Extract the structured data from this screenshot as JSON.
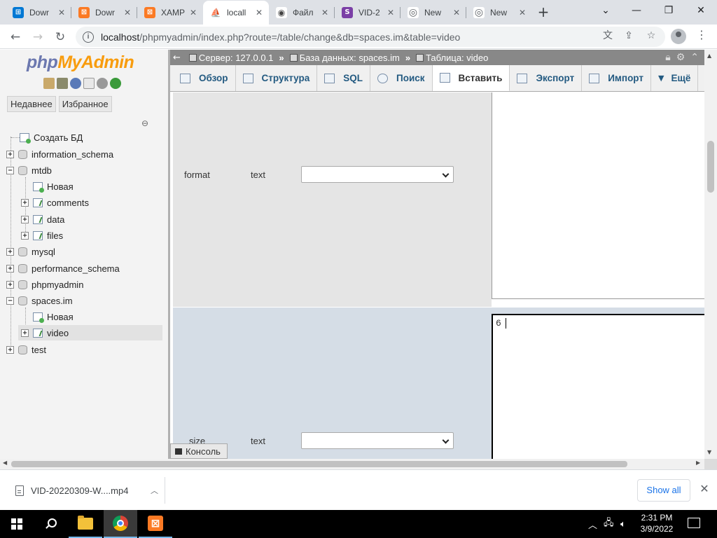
{
  "browser": {
    "tabs": [
      {
        "title": "Dowr",
        "icon": "windows-icon",
        "color": "#0078d4"
      },
      {
        "title": "Dowr",
        "icon": "xampp-icon",
        "color": "#fb7a24"
      },
      {
        "title": "XAMP",
        "icon": "xampp-icon",
        "color": "#fb7a24"
      },
      {
        "title": "locall",
        "icon": "phpmyadmin-icon",
        "color": "#6c78af",
        "active": true
      },
      {
        "title": "Файл",
        "icon": "eye-icon",
        "color": "#444444"
      },
      {
        "title": "VID-2",
        "icon": "s-icon",
        "color": "#7b3fa6"
      },
      {
        "title": "New",
        "icon": "chrome-icon",
        "color": "#5f6368"
      },
      {
        "title": "New",
        "icon": "chrome-icon",
        "color": "#5f6368"
      }
    ],
    "url_host": "localhost",
    "url_path": "/phpmyadmin/index.php?route=/table/change&db=spaces.im&table=video"
  },
  "nav": {
    "logo_php": "php",
    "logo_myadmin": "MyAdmin",
    "tab_recent": "Недавнее",
    "tab_favorites": "Избранное",
    "create_db": "Создать БД",
    "databases": [
      {
        "name": "information_schema"
      },
      {
        "name": "mtdb",
        "expanded": true
      },
      {
        "name": "mysql"
      },
      {
        "name": "performance_schema"
      },
      {
        "name": "phpmyadmin"
      },
      {
        "name": "spaces.im",
        "expanded": true
      },
      {
        "name": "test"
      }
    ],
    "mtdb_children": [
      "Новая",
      "comments",
      "data",
      "files"
    ],
    "spaces_children": [
      "Новая",
      "video"
    ]
  },
  "breadcrumb": {
    "server": "Сервер: 127.0.0.1",
    "database": "База данных: spaces.im",
    "table": "Таблица: video"
  },
  "menu": {
    "browse": "Обзор",
    "structure": "Структура",
    "sql": "SQL",
    "search": "Поиск",
    "insert": "Вставить",
    "export": "Экспорт",
    "import": "Импорт",
    "more": "Ещё"
  },
  "form": {
    "row_format": {
      "name": "format",
      "type": "text"
    },
    "row_size": {
      "name": "size",
      "type": "text",
      "value": "6"
    }
  },
  "console_label": "Консоль",
  "downloads": {
    "file": "VID-20220309-W....mp4",
    "show_all": "Show all"
  },
  "taskbar": {
    "time": "2:31 PM",
    "date": "3/9/2022"
  }
}
